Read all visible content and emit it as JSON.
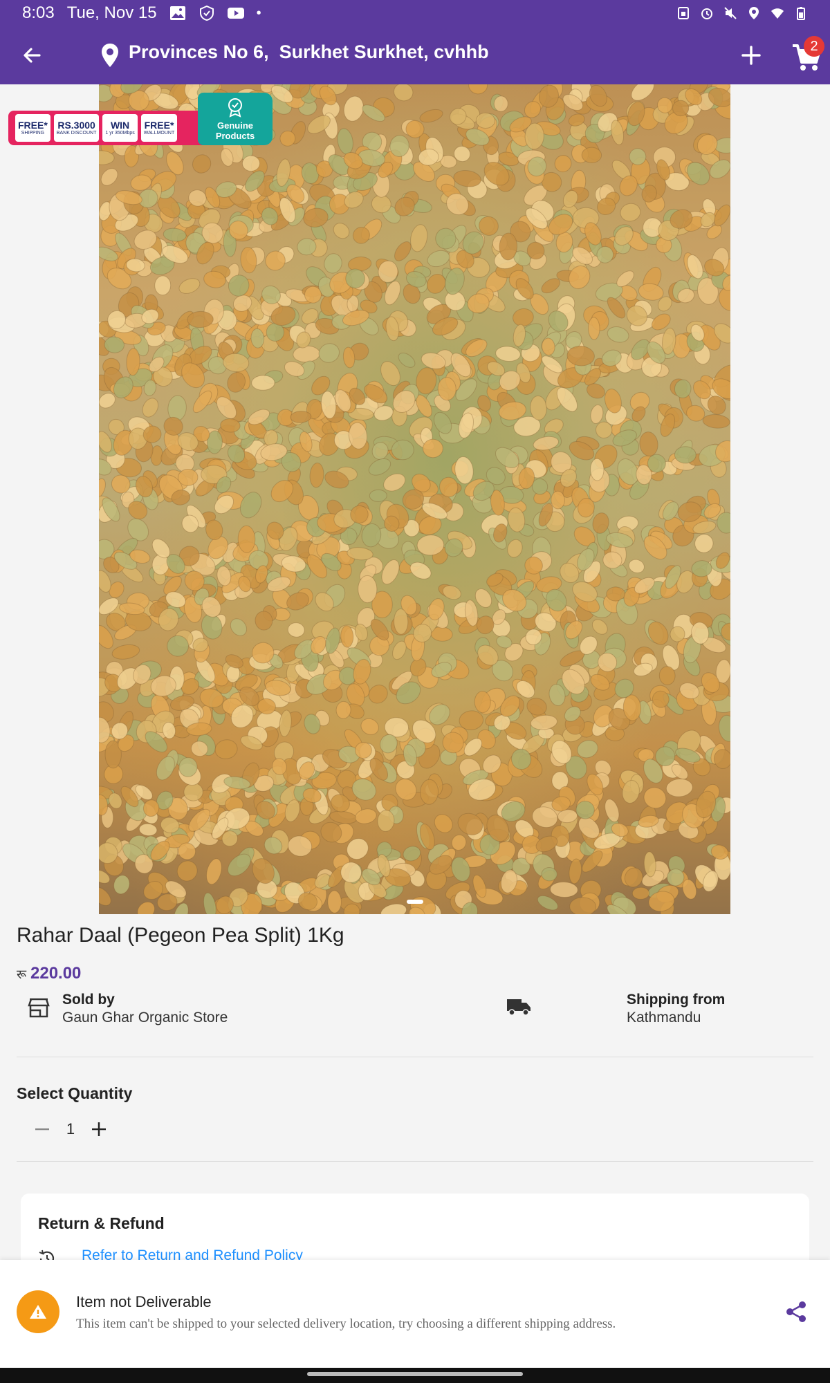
{
  "status_bar": {
    "time": "8:03",
    "date": "Tue, Nov 15",
    "left_icons": [
      "gallery-icon",
      "shield-icon",
      "youtube-icon",
      "dot-icon"
    ],
    "right_icons": [
      "sim-icon",
      "alarm-icon",
      "mute-icon",
      "location-icon",
      "wifi-icon",
      "battery-icon"
    ]
  },
  "app_bar": {
    "location": "Provinces No 6,  Surkhet Surkhet, cvhhb",
    "cart_count": "2",
    "color": "#5b3a9e"
  },
  "promo": {
    "chips": [
      {
        "big": "FREE*",
        "small": "SHIPPING"
      },
      {
        "big": "RS.3000",
        "small": "BANK DISCOUNT"
      },
      {
        "big": "WIN",
        "small": "1 yr 350Mbps"
      },
      {
        "big": "FREE*",
        "small": "WALLMOUNT"
      }
    ],
    "genuine_label": "Genuine\nProducts"
  },
  "product": {
    "title": "Rahar Daal (Pegeon Pea Split) 1Kg",
    "currency_symbol": "रू",
    "price": "220.00",
    "sold_by_label": "Sold by",
    "store_name": "Gaun Ghar Organic Store",
    "shipping_from_label": "Shipping from",
    "shipping_from": "Kathmandu"
  },
  "quantity": {
    "label": "Select Quantity",
    "value": "1"
  },
  "refund": {
    "title": "Return & Refund",
    "link": "Refer to Return and Refund Policy"
  },
  "notice": {
    "title": "Item not Deliverable",
    "body": "This item can't be shipped to your selected delivery location, try choosing a different shipping address.",
    "warning_color": "#f59a15"
  }
}
